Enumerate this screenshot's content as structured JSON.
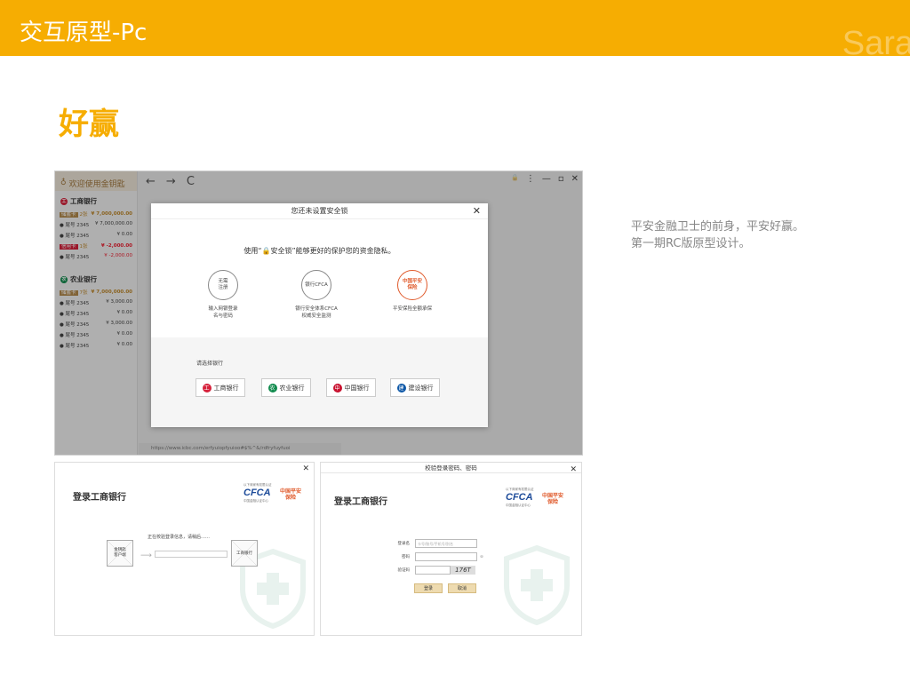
{
  "header": {
    "title": "交互原型-Pc",
    "watermark": "Sara"
  },
  "section": {
    "heading": "好赢"
  },
  "description": {
    "lines": [
      "平安金融卫士的前身，平安好赢。",
      "第一期RC版原型设计。"
    ]
  },
  "browser": {
    "sidebar": {
      "welcome": "欢迎使用金钥匙",
      "banks": [
        {
          "name": "工商银行",
          "card_tag": "储蓄卡",
          "card_count": "2张",
          "card_total": "¥ 7,000,000.00",
          "rows": [
            {
              "label": "● 尾号 2345",
              "amount": "¥ 7,000,000.00"
            },
            {
              "label": "● 尾号 2345",
              "amount": "¥ 0.00"
            }
          ],
          "credit_tag": "信用卡",
          "credit_count": "1张",
          "credit_total": "¥ -2,000.00",
          "credit_rows": [
            {
              "label": "● 尾号 2345",
              "amount": "¥ -2,000.00"
            }
          ]
        },
        {
          "name": "农业银行",
          "card_tag": "储蓄卡",
          "card_count": "7张",
          "card_total": "¥ 7,000,000.00",
          "rows": [
            {
              "label": "● 尾号 2345",
              "amount": "¥ 3,000.00"
            },
            {
              "label": "● 尾号 2345",
              "amount": "¥ 0.00"
            },
            {
              "label": "● 尾号 2345",
              "amount": "¥ 3,000.00"
            },
            {
              "label": "● 尾号 2345",
              "amount": "¥ 0.00"
            },
            {
              "label": "● 尾号 2345",
              "amount": "¥ 0.00"
            }
          ]
        }
      ]
    },
    "toolbar": {
      "back": "←",
      "forward": "→",
      "refresh": "C"
    },
    "window_controls": {
      "minimize": "—",
      "restore": "▫",
      "close": "✕",
      "menu": "⋮",
      "lock": "🔒"
    },
    "status_url": "https://www.icbc.com/erfyuiopfyuioo#$%^&/rdfryfuyfuoi",
    "dialog": {
      "title": "您还未设置安全锁",
      "close": "✕",
      "message_prefix": "使用“",
      "message_lock": "安全锁",
      "message_suffix": "”能够更好的保护您的资金隐私。",
      "features": [
        {
          "circle": "无需\n注册",
          "caption": "输入网银登录\n名与密码"
        },
        {
          "circle": "银行CFCA",
          "caption": "银行安全体系CFCA\n权威安全监测"
        },
        {
          "circle": "中国平安\n保险",
          "caption": "平安保险全额承保"
        }
      ],
      "bank_select_label": "请选择银行",
      "banks": [
        {
          "name": "工商银行",
          "color": "#d6213b"
        },
        {
          "name": "农业银行",
          "color": "#0f8a4c"
        },
        {
          "name": "中国银行",
          "color": "#c8102e"
        },
        {
          "name": "建设银行",
          "color": "#0c56a6"
        }
      ]
    }
  },
  "login_panel_1": {
    "close": "✕",
    "title": "登录工商银行",
    "cfca": "CFCA",
    "cfca_org_top": "以下商家有权限认证",
    "cfca_org": "中国金融认证中心",
    "pingan": "中国平安\n保险",
    "status_text": "正在校验登录信息，请稍后……",
    "left_box_label": "金钥匙\n客户端",
    "right_box_label": "工商银行"
  },
  "login_panel_2": {
    "header": "校验登录密码、密码",
    "close": "✕",
    "title": "登录工商银行",
    "cfca": "CFCA",
    "cfca_org_top": "以下商家有权限认证",
    "cfca_org": "中国金融认证中心",
    "pingan": "中国平安\n保险",
    "fields": {
      "username_label": "登录名",
      "username_placeholder": "卡号/账号/手机号/别名",
      "password_label": "密码",
      "captcha_label": "验证码",
      "captcha_text": "176T"
    },
    "login_button": "登录",
    "cancel_button": "取消"
  }
}
